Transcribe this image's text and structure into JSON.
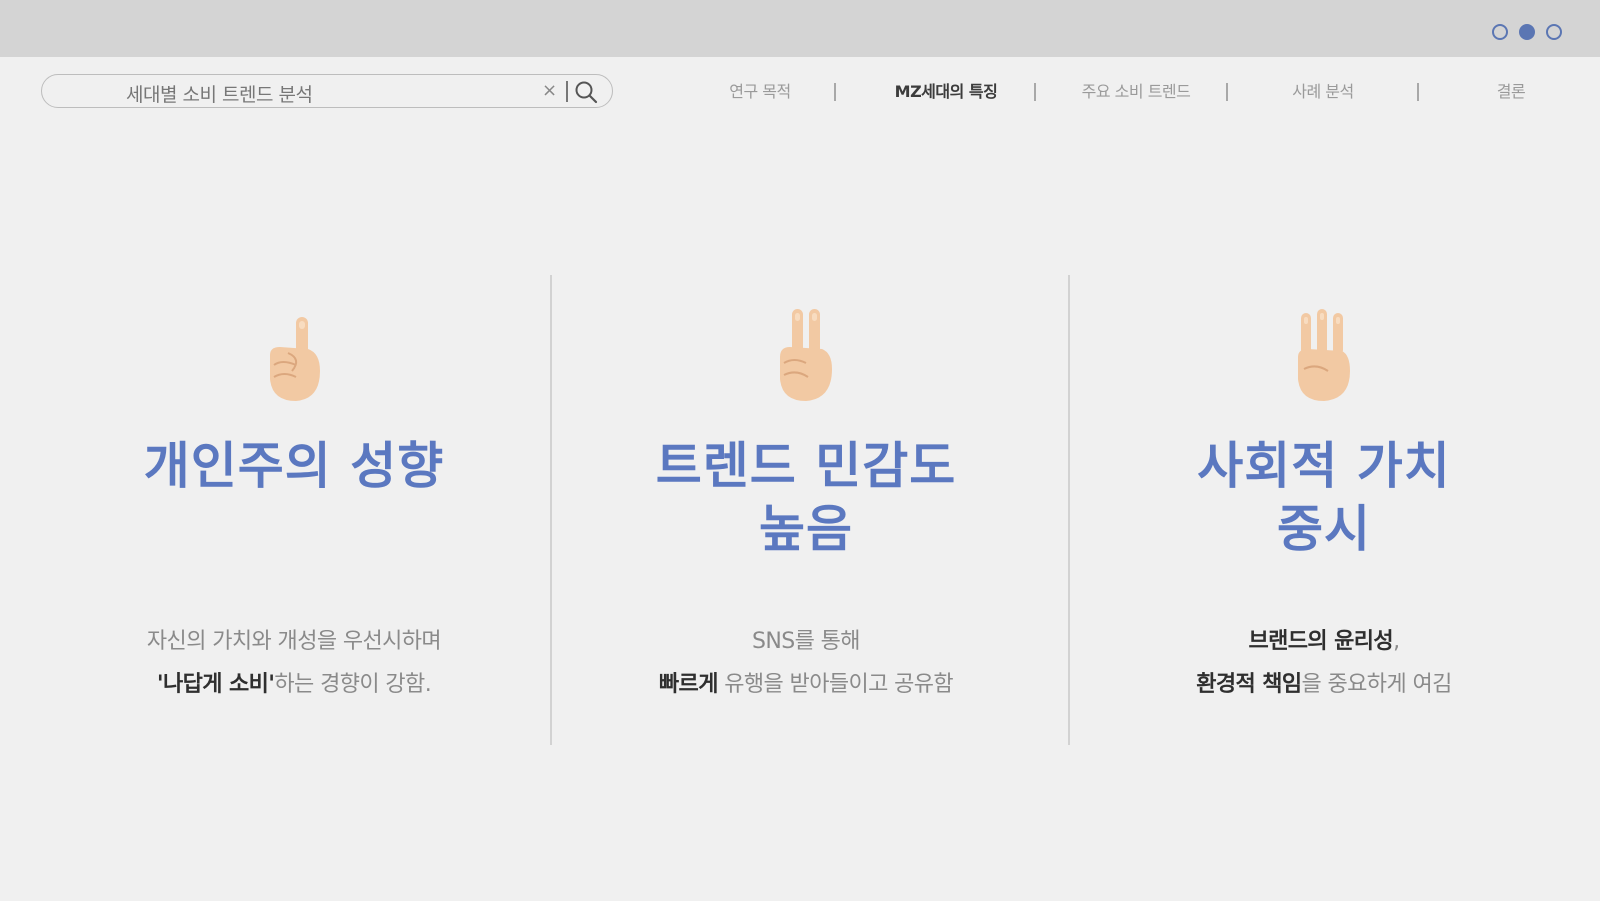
{
  "slide_indicators": [
    {
      "state": "inactive"
    },
    {
      "state": "active"
    },
    {
      "state": "inactive"
    }
  ],
  "search": {
    "value": "세대별 소비 트렌드 분석",
    "clear_glyph": "×"
  },
  "nav": {
    "items": [
      {
        "label": "연구 목적",
        "active": false
      },
      {
        "label": "MZ세대의 특징",
        "active": true
      },
      {
        "label": "주요 소비 트렌드",
        "active": false
      },
      {
        "label": "사례 분석",
        "active": false
      },
      {
        "label": "결론",
        "active": false
      }
    ]
  },
  "columns": [
    {
      "icon": "one-finger-hand",
      "title_line1": "개인주의 성향",
      "title_line2": "",
      "desc_line1": "자신의 가치와 개성을 우선시하며",
      "desc_line2_bold": "'나답게 소비'",
      "desc_line2_rest": "하는 경향이 강함."
    },
    {
      "icon": "two-finger-hand",
      "title_line1": "트렌드 민감도",
      "title_line2": "높음",
      "desc_line1": "SNS를 통해",
      "desc_line2_bold": "빠르게",
      "desc_line2_rest": " 유행을 받아들이고 공유함"
    },
    {
      "icon": "three-finger-hand",
      "title_line1": "사회적 가치",
      "title_line2": "중시",
      "desc_line1_bold": "브랜드의 윤리성",
      "desc_line1_rest": ",",
      "desc_line2_bold": "환경적 책임",
      "desc_line2_rest": "을 중요하게 여김"
    }
  ],
  "colors": {
    "accent": "#5b78c0",
    "topbar": "#d4d4d4",
    "background": "#f0f0f0",
    "skin": "#f2c9a3"
  }
}
